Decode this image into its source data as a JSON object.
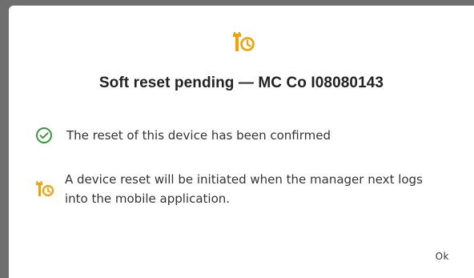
{
  "dialog": {
    "title": "Soft reset pending — MC Co I08080143",
    "header_icon": "wrench-clock-icon",
    "accent_color": "#f5a100",
    "success_color": "#3c9a3c",
    "messages": [
      {
        "icon": "check-circle-icon",
        "text": "The reset of this device has been confirmed"
      },
      {
        "icon": "wrench-clock-icon",
        "text": "A device reset will be initiated when the manager next logs into the mobile application."
      }
    ],
    "ok_label": "Ok"
  }
}
